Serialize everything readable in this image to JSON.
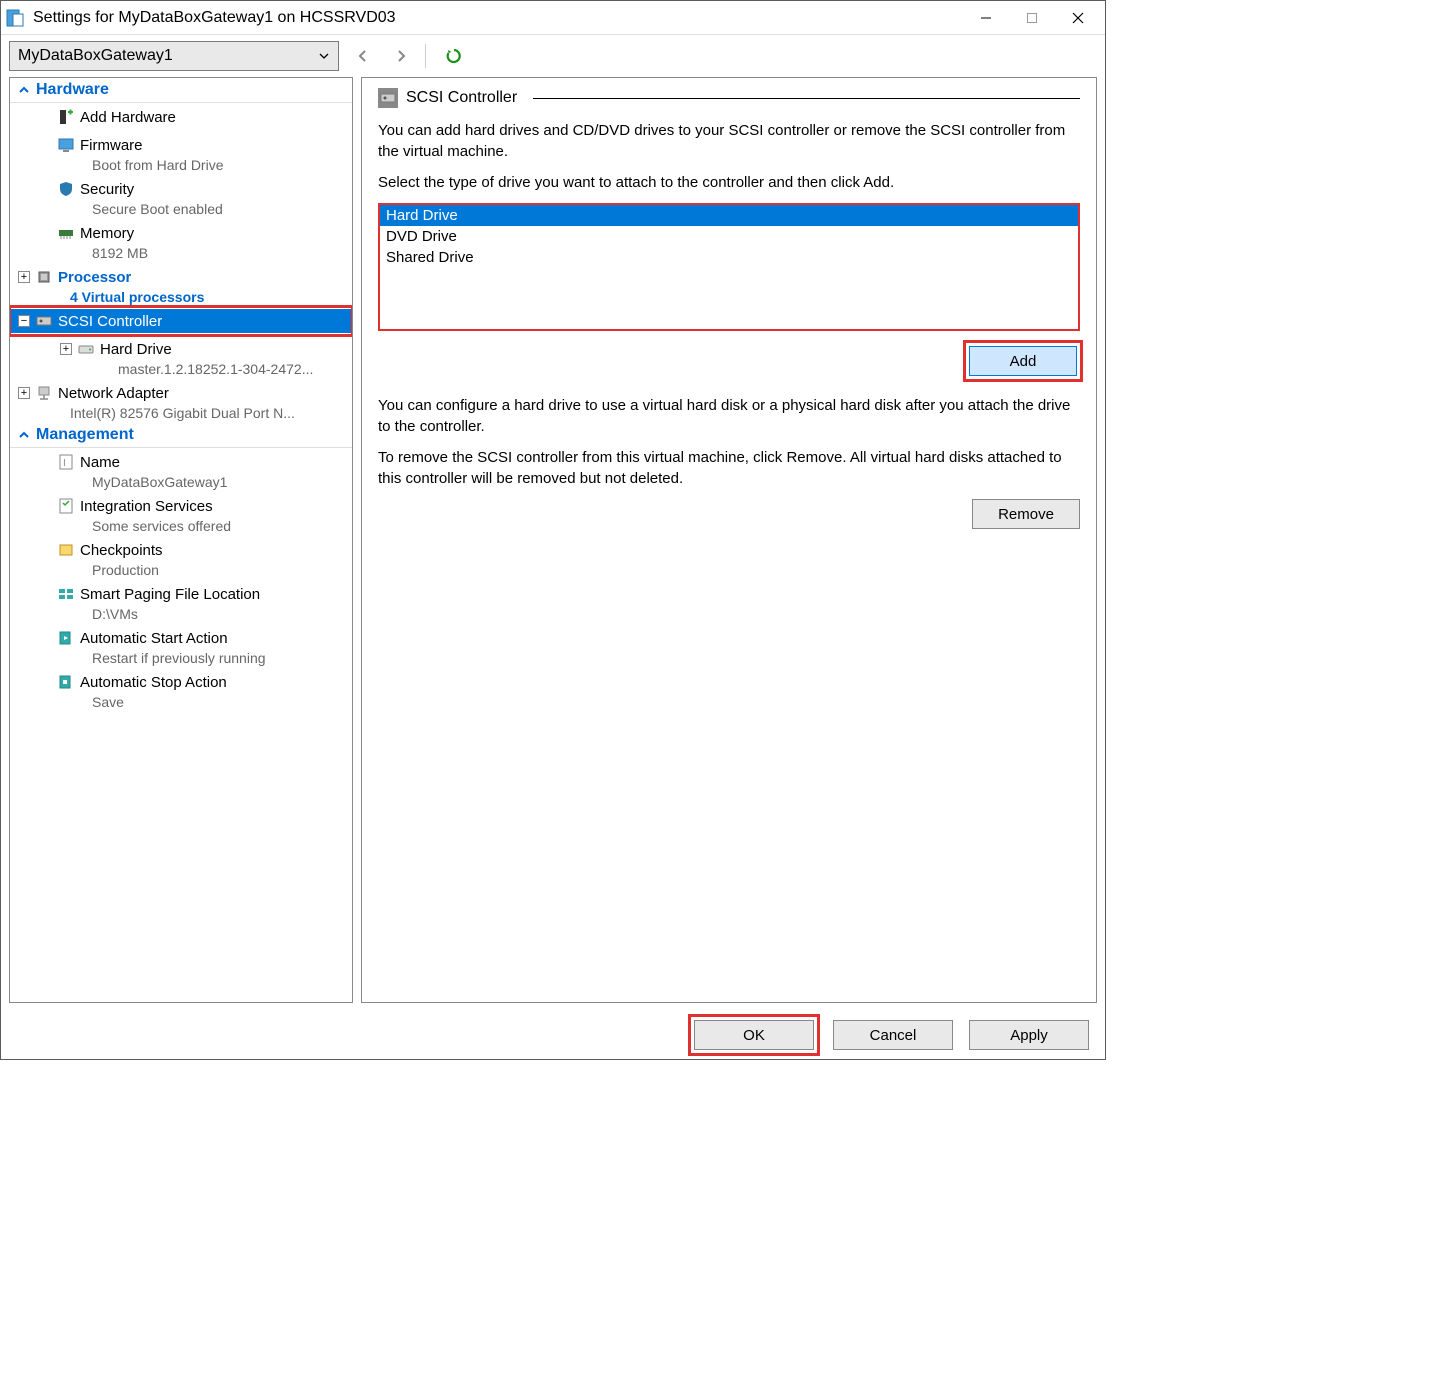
{
  "window": {
    "title": "Settings for MyDataBoxGateway1 on HCSSRVD03"
  },
  "toolbar": {
    "vm_name": "MyDataBoxGateway1"
  },
  "sidebar": {
    "hardware_header": "Hardware",
    "management_header": "Management",
    "add_hardware": "Add Hardware",
    "firmware": {
      "label": "Firmware",
      "sub": "Boot from Hard Drive"
    },
    "security": {
      "label": "Security",
      "sub": "Secure Boot enabled"
    },
    "memory": {
      "label": "Memory",
      "sub": "8192 MB"
    },
    "processor": {
      "label": "Processor",
      "sub": "4 Virtual processors"
    },
    "scsi": {
      "label": "SCSI Controller"
    },
    "hard_drive": {
      "label": "Hard Drive",
      "sub": "master.1.2.18252.1-304-2472..."
    },
    "network": {
      "label": "Network Adapter",
      "sub": "Intel(R) 82576 Gigabit Dual Port N..."
    },
    "name": {
      "label": "Name",
      "sub": "MyDataBoxGateway1"
    },
    "integration": {
      "label": "Integration Services",
      "sub": "Some services offered"
    },
    "checkpoints": {
      "label": "Checkpoints",
      "sub": "Production"
    },
    "paging": {
      "label": "Smart Paging File Location",
      "sub": "D:\\VMs"
    },
    "auto_start": {
      "label": "Automatic Start Action",
      "sub": "Restart if previously running"
    },
    "auto_stop": {
      "label": "Automatic Stop Action",
      "sub": "Save"
    }
  },
  "content": {
    "title": "SCSI Controller",
    "desc1": "You can add hard drives and CD/DVD drives to your SCSI controller or remove the SCSI controller from the virtual machine.",
    "desc2": "Select the type of drive you want to attach to the controller and then click Add.",
    "drive_options": [
      "Hard Drive",
      "DVD Drive",
      "Shared Drive"
    ],
    "add_button": "Add",
    "desc3": "You can configure a hard drive to use a virtual hard disk or a physical hard disk after you attach the drive to the controller.",
    "desc4": "To remove the SCSI controller from this virtual machine, click Remove. All virtual hard disks attached to this controller will be removed but not deleted.",
    "remove_button": "Remove"
  },
  "buttons": {
    "ok": "OK",
    "cancel": "Cancel",
    "apply": "Apply"
  }
}
